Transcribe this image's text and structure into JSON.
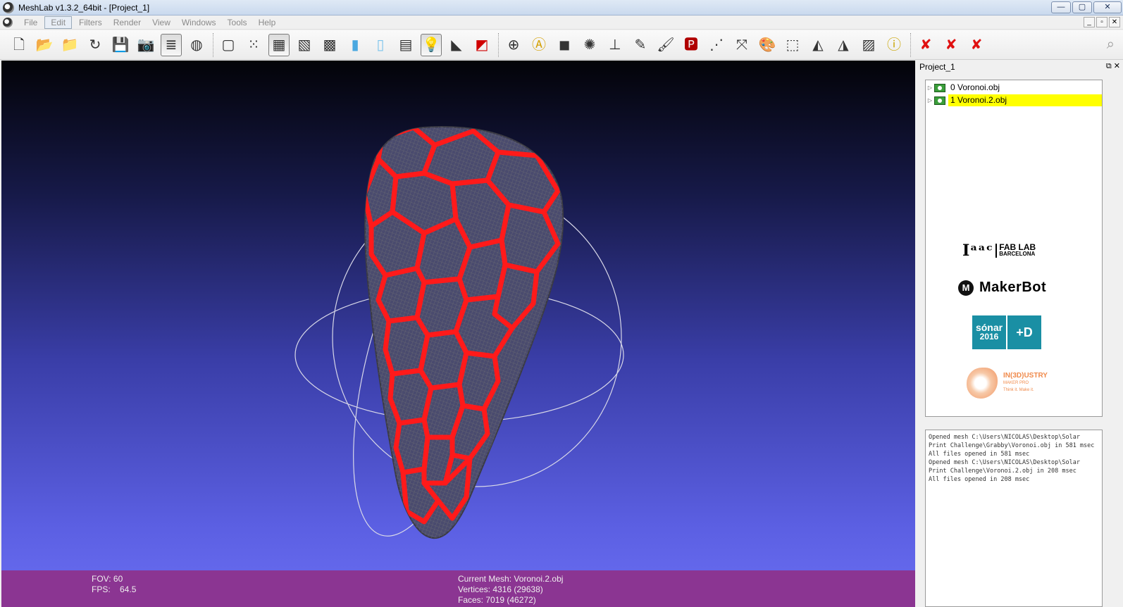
{
  "window": {
    "title": "MeshLab v1.3.2_64bit - [Project_1]",
    "controls": [
      "—",
      "▢",
      "✕"
    ],
    "mdi_controls": [
      "_",
      "▫",
      "✕"
    ]
  },
  "menu": {
    "items": [
      "File",
      "Edit",
      "Filters",
      "Render",
      "View",
      "Windows",
      "Tools",
      "Help"
    ],
    "active": "Edit"
  },
  "toolbar": {
    "buttons": [
      {
        "name": "new-project",
        "glyph": "🗋",
        "on": false
      },
      {
        "name": "open-project",
        "glyph": "📂",
        "on": false
      },
      {
        "name": "import-mesh",
        "glyph": "📁",
        "on": false
      },
      {
        "name": "reload",
        "glyph": "↻",
        "on": false
      },
      {
        "name": "save",
        "glyph": "💾",
        "on": false
      },
      {
        "name": "snapshot",
        "glyph": "📷",
        "on": false
      },
      {
        "name": "layers",
        "glyph": "≣",
        "on": true
      },
      {
        "name": "raster",
        "glyph": "◍",
        "on": false
      },
      {
        "sep": true
      },
      {
        "name": "bbox",
        "glyph": "▢",
        "on": false
      },
      {
        "name": "points",
        "glyph": "⁙",
        "on": false
      },
      {
        "name": "wireframe",
        "glyph": "▦",
        "on": true
      },
      {
        "name": "hidden-lines",
        "glyph": "▧",
        "on": false
      },
      {
        "name": "flat-lines",
        "glyph": "▩",
        "on": false
      },
      {
        "name": "flat",
        "glyph": "▮",
        "on": false
      },
      {
        "name": "smooth",
        "glyph": "▯",
        "on": false
      },
      {
        "name": "texture",
        "glyph": "▤",
        "on": false
      },
      {
        "name": "lighting",
        "glyph": "💡",
        "on": true
      },
      {
        "name": "backface",
        "glyph": "◣",
        "on": false
      },
      {
        "name": "color",
        "glyph": "◩",
        "on": false
      },
      {
        "sep": true
      },
      {
        "name": "trackball",
        "glyph": "⊕",
        "on": false
      },
      {
        "name": "annotation",
        "glyph": "Ⓐ",
        "on": false
      },
      {
        "name": "quality",
        "glyph": "◼",
        "on": false
      },
      {
        "name": "sphere",
        "glyph": "✺",
        "on": false
      },
      {
        "name": "axis",
        "glyph": "⊥",
        "on": false
      },
      {
        "name": "measure",
        "glyph": "✎",
        "on": false
      },
      {
        "name": "paint",
        "glyph": "🖌",
        "on": false
      },
      {
        "name": "pick-points",
        "glyph": "🅿",
        "on": false
      },
      {
        "name": "align",
        "glyph": "⋰",
        "on": false
      },
      {
        "name": "manipulate",
        "glyph": "⤧",
        "on": false
      },
      {
        "name": "paint-color",
        "glyph": "🎨",
        "on": false
      },
      {
        "name": "select",
        "glyph": "⬚",
        "on": false
      },
      {
        "name": "select-faces",
        "glyph": "◭",
        "on": false
      },
      {
        "name": "select-vertices",
        "glyph": "◮",
        "on": false
      },
      {
        "name": "raster-align",
        "glyph": "▨",
        "on": false
      },
      {
        "name": "info",
        "glyph": "ⓘ",
        "on": false
      },
      {
        "sep": true
      },
      {
        "name": "delete-faces",
        "glyph": "✘",
        "on": false
      },
      {
        "name": "delete-verts",
        "glyph": "✘",
        "on": false
      },
      {
        "name": "delete-edges",
        "glyph": "✘",
        "on": false
      }
    ]
  },
  "colors": {
    "mesh_highlight": "#ff1a1a",
    "status_bg": "#8b3592",
    "selected_layer": "#ffff00"
  },
  "status": {
    "fov": "FOV: 60",
    "fps": "FPS:    64.5",
    "current_mesh": "Current Mesh: Voronoi.2.obj",
    "vertices": "Vertices: 4316 (29638)",
    "faces": "Faces: 7019 (46272)"
  },
  "panel": {
    "title": "Project_1",
    "layers": [
      {
        "label": "0  Voronoi.obj",
        "selected": false
      },
      {
        "label": "1  Voronoi.2.obj",
        "selected": true
      }
    ],
    "logos": {
      "iaac_main": "Iᵃᵃᶜ",
      "iaac_fablab": "FAB LAB",
      "iaac_city": "BARCELONA",
      "makerbot": "MakerBot",
      "makerbot_mark": "M",
      "sonar_name": "sónar",
      "sonar_year": "2016",
      "sonar_plus": "+D",
      "industry_name": "IN(3D)USTRY",
      "industry_sub": "MAKER PRO",
      "industry_tag": "Think it. Make it."
    }
  },
  "log": {
    "lines": [
      "Opened mesh C:\\Users\\NICOLAS\\Desktop\\Solar Print Challenge\\Grabby\\Voronoi.obj in 581 msec",
      "All files opened in 581 msec",
      "Opened mesh C:\\Users\\NICOLAS\\Desktop\\Solar Print Challenge\\Voronoi.2.obj in 208 msec",
      "All files opened in 208 msec"
    ]
  }
}
